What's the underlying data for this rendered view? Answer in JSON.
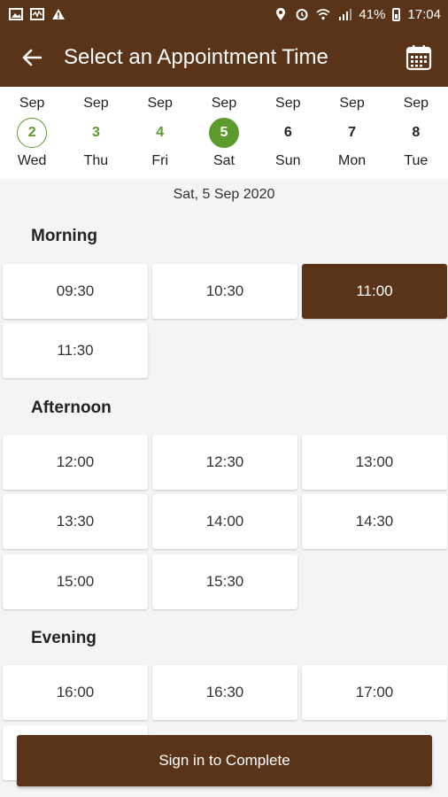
{
  "status_bar": {
    "battery": "41%",
    "time": "17:04"
  },
  "app_bar": {
    "title": "Select an Appointment Time"
  },
  "days": [
    {
      "month": "Sep",
      "num": "2",
      "name": "Wed",
      "state": "today"
    },
    {
      "month": "Sep",
      "num": "3",
      "name": "Thu",
      "state": "available"
    },
    {
      "month": "Sep",
      "num": "4",
      "name": "Fri",
      "state": "available"
    },
    {
      "month": "Sep",
      "num": "5",
      "name": "Sat",
      "state": "selected"
    },
    {
      "month": "Sep",
      "num": "6",
      "name": "Sun",
      "state": "default"
    },
    {
      "month": "Sep",
      "num": "7",
      "name": "Mon",
      "state": "default"
    },
    {
      "month": "Sep",
      "num": "8",
      "name": "Tue",
      "state": "default"
    }
  ],
  "selected_date": "Sat, 5 Sep 2020",
  "sections": {
    "morning": {
      "title": "Morning",
      "slots": [
        "09:30",
        "10:30",
        "11:00",
        "11:30"
      ]
    },
    "afternoon": {
      "title": "Afternoon",
      "slots": [
        "12:00",
        "12:30",
        "13:00",
        "13:30",
        "14:00",
        "14:30",
        "15:00",
        "15:30"
      ]
    },
    "evening": {
      "title": "Evening",
      "slots": [
        "16:00",
        "16:30",
        "17:00"
      ]
    }
  },
  "selected_slot": "11:00",
  "cta_label": "Sign in to Complete",
  "colors": {
    "brand": "#5a3418",
    "accent_green": "#5b9a2d"
  }
}
